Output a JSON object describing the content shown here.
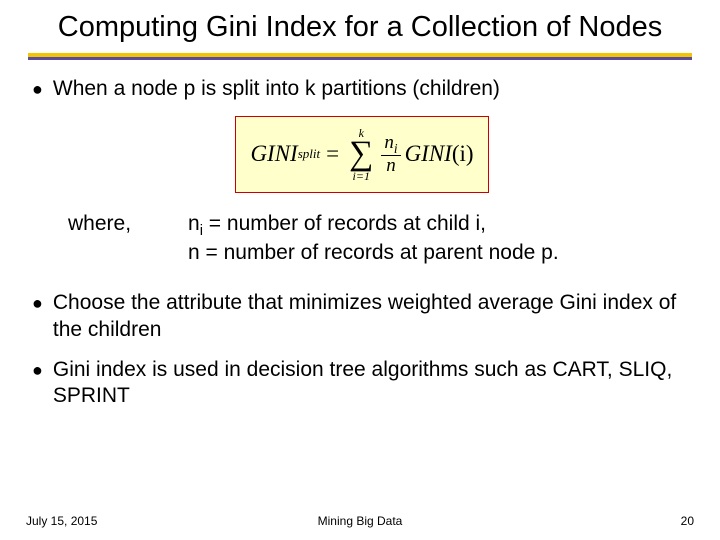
{
  "title": "Computing Gini Index for a Collection of Nodes",
  "bullets": {
    "b1": "When a node p is split into k partitions (children)",
    "b2": "Choose the attribute that minimizes weighted average Gini index of the children",
    "b3": "Gini index is used in decision tree algorithms such as CART, SLIQ, SPRINT"
  },
  "formula": {
    "lhs_name": "GINI",
    "lhs_sub": "split",
    "eq": "=",
    "sum_upper": "k",
    "sum_lower": "i=1",
    "frac_num_var": "n",
    "frac_num_sub": "i",
    "frac_den": "n",
    "rhs_name": "GINI",
    "rhs_arg": "(i)"
  },
  "where": {
    "label": "where,",
    "line1_lhs": "n",
    "line1_sub": "i",
    "line1_rest": " = number of records at child i,",
    "line2": "n  = number of records at parent node p."
  },
  "footer": {
    "date": "July 15, 2015",
    "center": "Mining Big Data",
    "page": "20"
  }
}
